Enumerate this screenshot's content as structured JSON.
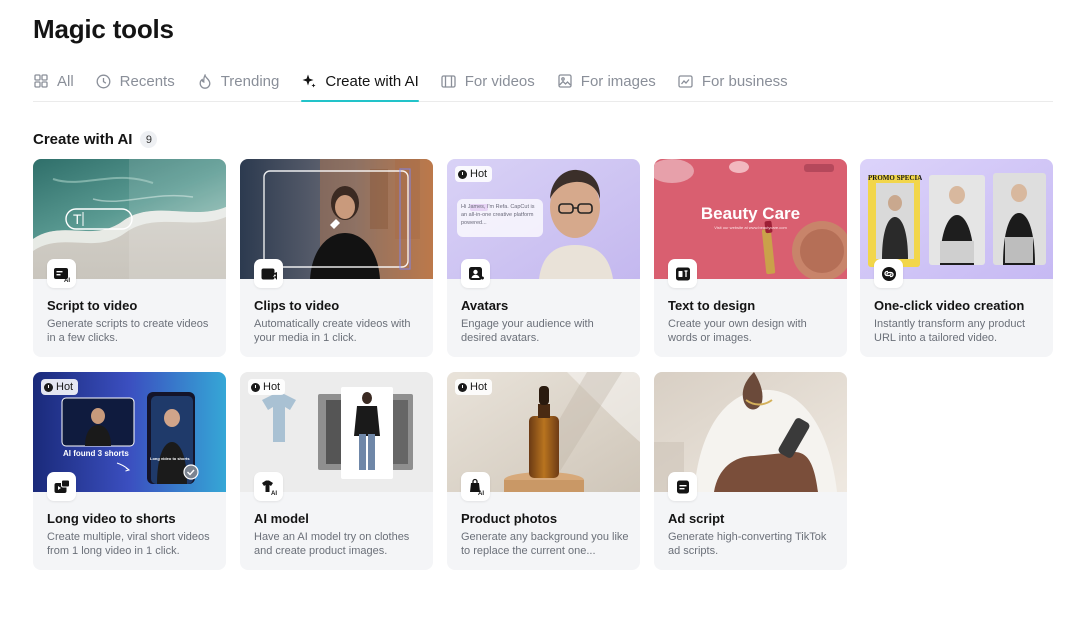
{
  "page": {
    "title": "Magic tools"
  },
  "tabs": [
    {
      "label": "All",
      "icon": "grid-icon"
    },
    {
      "label": "Recents",
      "icon": "clock-icon"
    },
    {
      "label": "Trending",
      "icon": "flame-icon"
    },
    {
      "label": "Create with AI",
      "icon": "sparkle-icon",
      "active": true
    },
    {
      "label": "For videos",
      "icon": "film-icon"
    },
    {
      "label": "For images",
      "icon": "image-icon"
    },
    {
      "label": "For business",
      "icon": "business-icon"
    }
  ],
  "section": {
    "title": "Create with AI",
    "count": "9"
  },
  "cards": [
    {
      "title": "Script to video",
      "desc": "Generate scripts to create videos in a few clicks.",
      "icon": "script-icon"
    },
    {
      "title": "Clips to video",
      "desc": "Automatically create videos with your media in 1 click.",
      "icon": "clips-icon"
    },
    {
      "title": "Avatars",
      "desc": "Engage your audience with desired avatars.",
      "icon": "avatar-icon",
      "hot": "Hot",
      "thumb": {
        "bubble": "Hi James, I'm Refa. CapCut is an all-in-one creative platform powered..."
      }
    },
    {
      "title": "Text to design",
      "desc": "Create your own design with words or images.",
      "icon": "text-design-icon",
      "thumb": {
        "headline": "Beauty Care",
        "sub": "Visit our website at www.beautycare.com"
      }
    },
    {
      "title": "One-click video creation",
      "desc": "Instantly transform any product URL into a tailored video.",
      "icon": "link-video-icon",
      "thumb": {
        "promo": "PROMO SPECIAL"
      }
    },
    {
      "title": "Long video to shorts",
      "desc": "Create multiple, viral short videos from 1 long video in 1 click.",
      "icon": "shorts-icon",
      "hot": "Hot",
      "thumb": {
        "found": "AI found 3 shorts",
        "clip": "Long video to shorts"
      }
    },
    {
      "title": "AI model",
      "desc": "Have an AI model try on clothes and create product images.",
      "icon": "ai-model-icon",
      "hot": "Hot"
    },
    {
      "title": "Product photos",
      "desc": "Generate any background you like to replace the current one...",
      "icon": "product-photo-icon",
      "hot": "Hot"
    },
    {
      "title": "Ad script",
      "desc": "Generate high-converting TikTok ad scripts.",
      "icon": "ad-script-icon"
    }
  ],
  "colors": {
    "accent": "#22c3c9",
    "card_bg": "#f4f5f7",
    "text_muted": "#6b7079",
    "tab_muted": "#8a8f99"
  }
}
